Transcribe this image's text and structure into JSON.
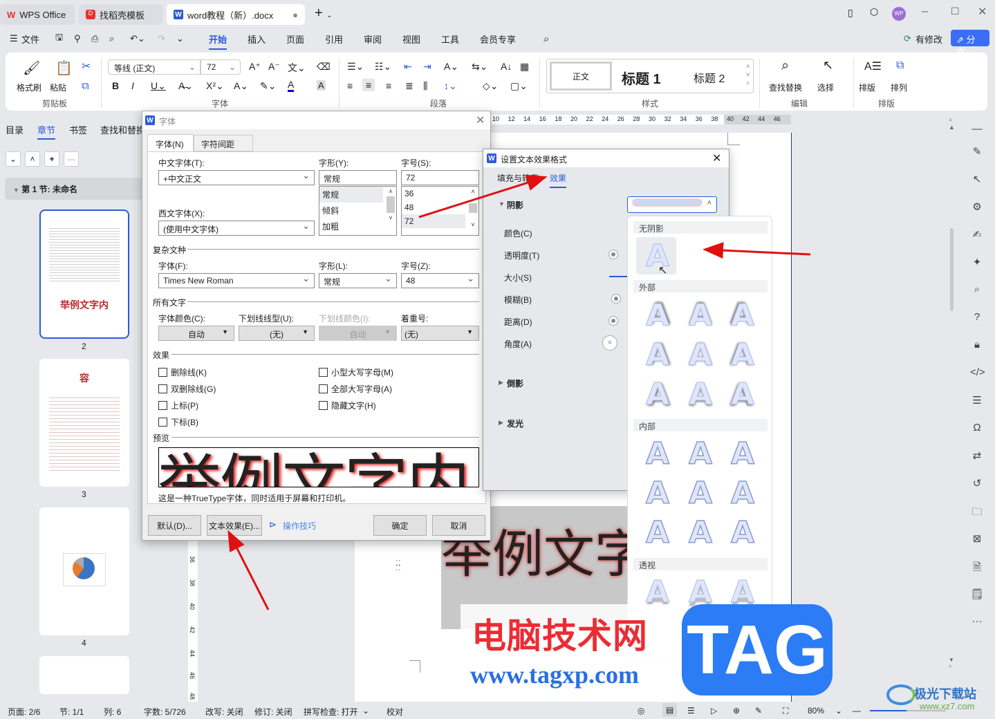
{
  "tabs": [
    {
      "label": "WPS Office"
    },
    {
      "label": "找稻壳模板"
    },
    {
      "label": "word教程（新）.docx"
    }
  ],
  "menu": {
    "file": "文件",
    "items": [
      "开始",
      "插入",
      "页面",
      "引用",
      "审阅",
      "视图",
      "工具",
      "会员专享"
    ],
    "modified": "有修改",
    "share": "分享",
    "avatar": "WP"
  },
  "ribbon": {
    "format_painter": "格式刷",
    "paste": "粘贴",
    "clipboard": "剪贴板",
    "font_name": "等线 (正文)",
    "font_size": "72",
    "font_group": "字体",
    "paragraph_group": "段落",
    "styles": [
      "正文",
      "标题 1",
      "标题 2"
    ],
    "styles_group": "样式",
    "find_replace": "查找替换",
    "select": "选择",
    "edit_group": "编辑",
    "layout": "排版",
    "arrange": "排列",
    "layout_group": "排版"
  },
  "nav": {
    "tabs": [
      "目录",
      "章节",
      "书签",
      "查找和替换"
    ],
    "section": "第 1 节: 未命名",
    "pages": [
      {
        "num": "2",
        "title": "举例文字内"
      },
      {
        "num": "3",
        "title": "容"
      },
      {
        "num": "4"
      }
    ]
  },
  "ruler": {
    "marks": [
      "10",
      "12",
      "14",
      "16",
      "18",
      "20",
      "22",
      "24",
      "26",
      "28",
      "30",
      "32",
      "34",
      "36",
      "38",
      "40",
      "42",
      "44",
      "46"
    ],
    "vmarks": [
      "36",
      "38",
      "40",
      "42",
      "44",
      "46",
      "48"
    ]
  },
  "document": {
    "text": "举例文字"
  },
  "font_dialog": {
    "title": "字体",
    "tabs": [
      "字体(N)",
      "字符间距(R)"
    ],
    "cn_font_label": "中文字体(T):",
    "cn_font": "+中文正文",
    "style_label": "字形(Y):",
    "style": "常规",
    "style_options": [
      "常规",
      "倾斜",
      "加粗"
    ],
    "size_label": "字号(S):",
    "size": "72",
    "size_options": [
      "36",
      "48",
      "72"
    ],
    "west_font_label": "西文字体(X):",
    "west_font": "(使用中文字体)",
    "complex_section": "复杂文种",
    "complex_font_label": "字体(F):",
    "complex_font": "Times New Roman",
    "complex_style_label": "字形(L):",
    "complex_style": "常规",
    "complex_size_label": "字号(Z):",
    "complex_size": "48",
    "all_text_section": "所有文字",
    "color_label": "字体颜色(C):",
    "color": "自动",
    "underline_label": "下划线线型(U):",
    "underline": "(无)",
    "underline_color_label": "下划线颜色(I):",
    "underline_color": "自动",
    "emphasis_label": "着重号:",
    "emphasis": "(无)",
    "effects_section": "效果",
    "effects": [
      "删除线(K)",
      "双删除线(G)",
      "上标(P)",
      "下标(B)",
      "小型大写字母(M)",
      "全部大写字母(A)",
      "隐藏文字(H)"
    ],
    "preview_section": "预览",
    "preview_text": "举例文字内",
    "preview_note": "这是一种TrueType字体，同时适用于屏幕和打印机。",
    "default_btn": "默认(D)...",
    "text_effect_btn": "文本效果(E)...",
    "tips": "操作技巧",
    "ok": "确定",
    "cancel": "取消"
  },
  "effect_panel": {
    "title": "设置文本效果格式",
    "tabs": [
      "填充与轮廓",
      "效果"
    ],
    "shadow": "阴影",
    "props": [
      "颜色(C)",
      "透明度(T)",
      "大小(S)",
      "模糊(B)",
      "距离(D)",
      "角度(A)"
    ],
    "reflection": "倒影",
    "glow": "发光"
  },
  "shadow_dropdown": {
    "sections": [
      "无阴影",
      "外部",
      "内部",
      "透视"
    ],
    "glyph": "A"
  },
  "watermark": {
    "site_cn": "电脑技术网",
    "url": "www.tagxp.com",
    "tag": "TAG",
    "corner": "极光下载站",
    "corner_url": "www.xz7.com"
  },
  "status": {
    "page": "页面: 2/6",
    "section": "节: 1/1",
    "col": "列: 6",
    "words": "字数: 5/726",
    "overwrite": "改写: 关闭",
    "revision": "修订: 关闭",
    "spell": "拼写检查: 打开",
    "proof": "校对",
    "zoom": "80%"
  },
  "colors": {
    "accent": "#2b5bd7",
    "share": "#3b6ef5",
    "arrow": "#e01010"
  }
}
